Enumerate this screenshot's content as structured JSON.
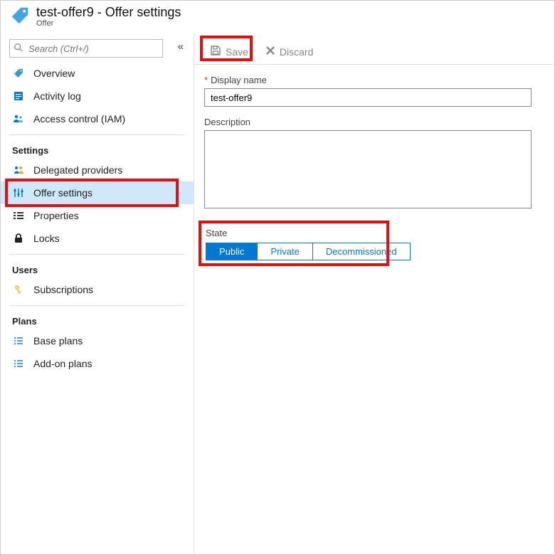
{
  "header": {
    "title": "test-offer9 - Offer settings",
    "subtitle": "Offer"
  },
  "search": {
    "placeholder": "Search (Ctrl+/)"
  },
  "nav": {
    "top": [
      {
        "label": "Overview",
        "icon": "tag"
      },
      {
        "label": "Activity log",
        "icon": "log"
      },
      {
        "label": "Access control (IAM)",
        "icon": "iam"
      }
    ],
    "groups": [
      {
        "label": "Settings",
        "items": [
          {
            "label": "Delegated providers",
            "icon": "providers"
          },
          {
            "label": "Offer settings",
            "icon": "sliders",
            "active": true
          },
          {
            "label": "Properties",
            "icon": "properties"
          },
          {
            "label": "Locks",
            "icon": "lock"
          }
        ]
      },
      {
        "label": "Users",
        "items": [
          {
            "label": "Subscriptions",
            "icon": "key"
          }
        ]
      },
      {
        "label": "Plans",
        "items": [
          {
            "label": "Base plans",
            "icon": "list"
          },
          {
            "label": "Add-on plans",
            "icon": "list"
          }
        ]
      }
    ]
  },
  "toolbar": {
    "save_label": "Save",
    "discard_label": "Discard"
  },
  "form": {
    "display_name_label": "Display name",
    "display_name_value": "test-offer9",
    "description_label": "Description",
    "description_value": "",
    "state_label": "State",
    "state_options": [
      "Public",
      "Private",
      "Decommissioned"
    ],
    "state_selected": "Public"
  }
}
